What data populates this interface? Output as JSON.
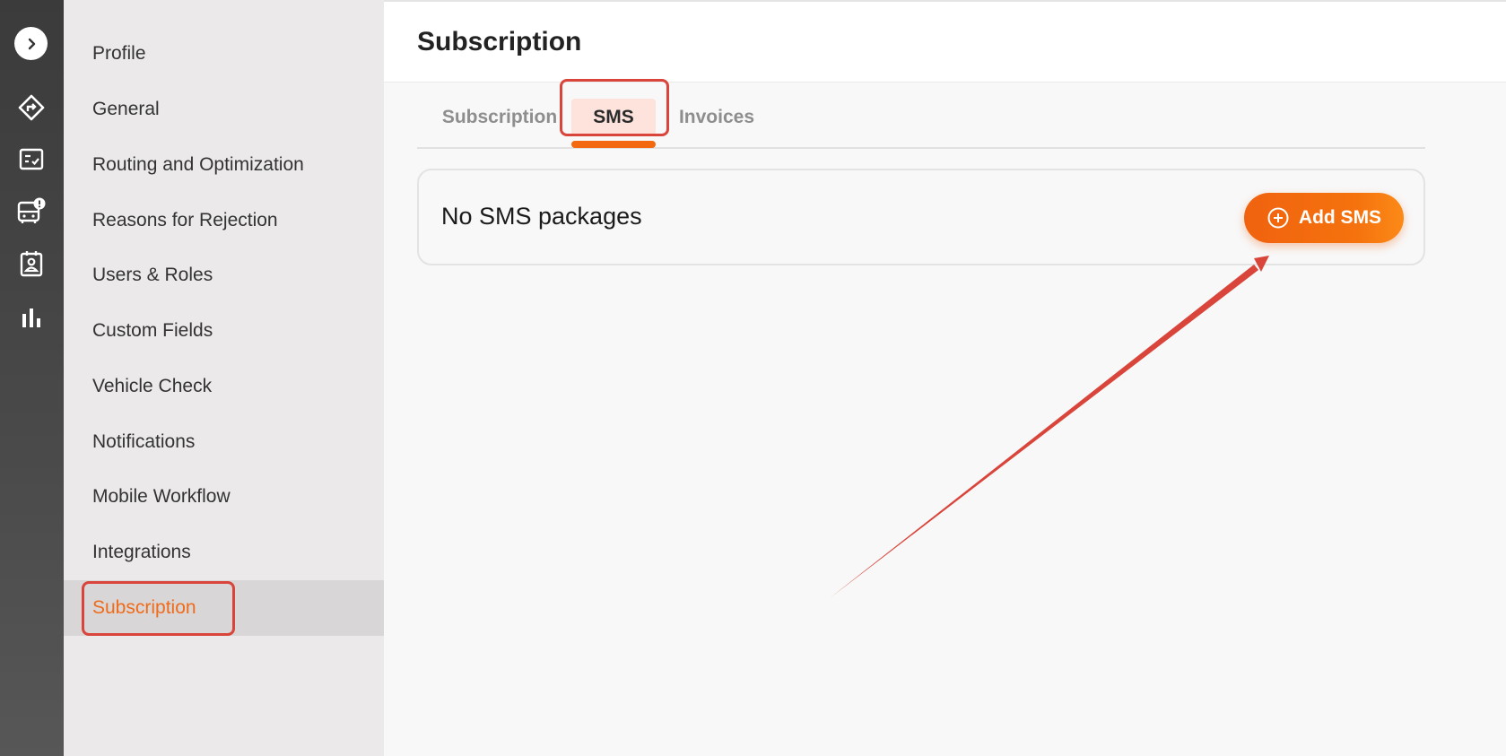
{
  "rail": {
    "icons": [
      "chevron-right-icon",
      "route-icon",
      "checklist-icon",
      "vehicle-alert-icon",
      "contact-card-icon",
      "bar-chart-icon"
    ]
  },
  "sidebar": {
    "items": [
      {
        "label": "Profile"
      },
      {
        "label": "General"
      },
      {
        "label": "Routing and Optimization"
      },
      {
        "label": "Reasons for Rejection"
      },
      {
        "label": "Users & Roles"
      },
      {
        "label": "Custom Fields"
      },
      {
        "label": "Vehicle Check"
      },
      {
        "label": "Notifications"
      },
      {
        "label": "Mobile Workflow"
      },
      {
        "label": "Integrations"
      },
      {
        "label": "Subscription",
        "active": true
      }
    ]
  },
  "header": {
    "title": "Subscription"
  },
  "tabs": [
    {
      "label": "Subscription"
    },
    {
      "label": "SMS",
      "active": true
    },
    {
      "label": "Invoices"
    }
  ],
  "sms_card": {
    "empty_text": "No SMS packages",
    "add_button_label": "Add SMS",
    "add_button_icon": "plus-circle-icon"
  },
  "colors": {
    "accent": "#f06b1a",
    "annotation": "#d9453b",
    "active_tab_bg": "#fde3dc"
  }
}
